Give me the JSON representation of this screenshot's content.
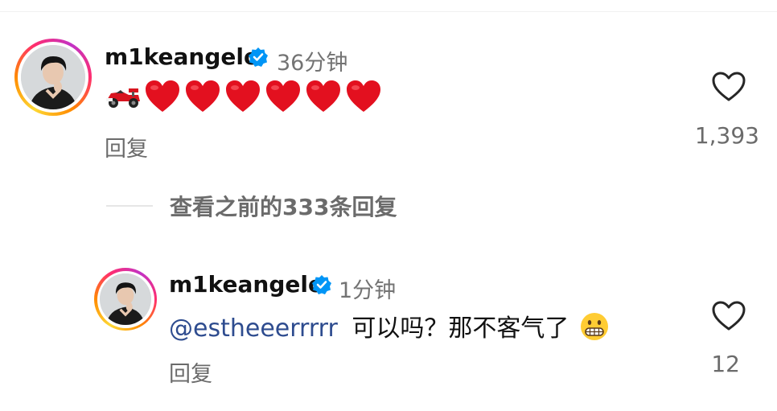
{
  "comments": [
    {
      "username": "m1keangelo",
      "time": "36分钟",
      "body_emojis": [
        "race-car",
        "red-heart",
        "red-heart",
        "red-heart",
        "red-heart",
        "red-heart",
        "red-heart"
      ],
      "reply_label": "回复",
      "like_count": "1,393"
    }
  ],
  "view_previous": "查看之前的333条回复",
  "replies": [
    {
      "username": "m1keangelo",
      "time": "1分钟",
      "mention": "@estheeerrrrr",
      "text": "可以吗？那不客气了",
      "emoji": "grimacing-face",
      "reply_label": "回复",
      "like_count": "12"
    }
  ],
  "colors": {
    "mention": "#2e4c8f",
    "verified": "#0095f6",
    "heart": "#e3101f",
    "secondary_text": "#737373"
  },
  "icons": {
    "verified": "verified-badge-icon",
    "like": "heart-outline-icon"
  }
}
